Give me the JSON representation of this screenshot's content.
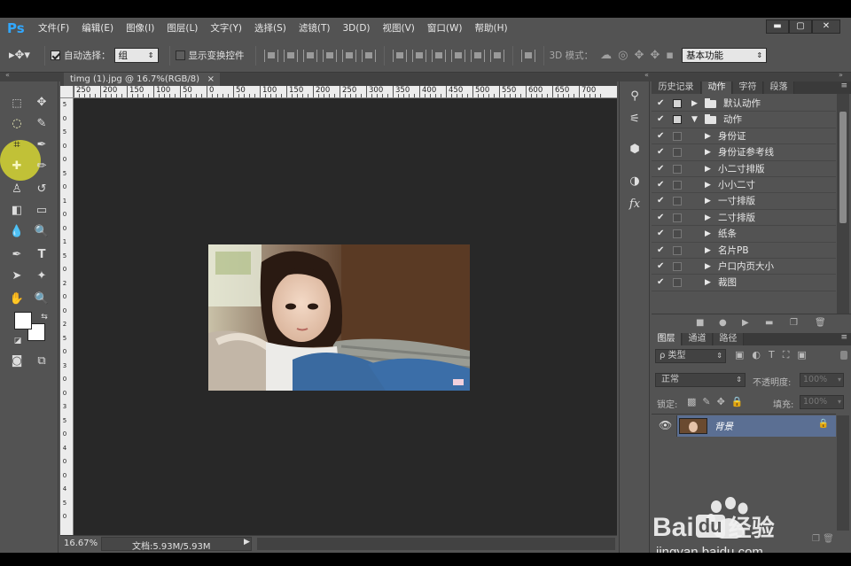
{
  "app": {
    "logo": "Ps"
  },
  "menu": [
    "文件(F)",
    "编辑(E)",
    "图像(I)",
    "图层(L)",
    "文字(Y)",
    "选择(S)",
    "滤镜(T)",
    "3D(D)",
    "视图(V)",
    "窗口(W)",
    "帮助(H)"
  ],
  "window_controls": {
    "minimize": "▬",
    "maximize": "▢",
    "close": "✕"
  },
  "options": {
    "auto_select_label": "自动选择：",
    "auto_select_value": "组",
    "show_transform_label": "显示变换控件",
    "mode_3d_label": "3D 模式：",
    "workspace_value": "基本功能"
  },
  "document": {
    "tab_title": "timg (1).jpg @ 16.7%(RGB/8)",
    "tab_close": "×",
    "zoom": "16.67%",
    "doc_info": "文档:5.93M/5.93M",
    "ruler_h": [
      "250",
      "200",
      "150",
      "100",
      "50",
      "0",
      "50",
      "100",
      "150",
      "200",
      "250",
      "300",
      "350",
      "400",
      "450",
      "500",
      "550",
      "600",
      "650",
      "700"
    ],
    "ruler_v": [
      "5",
      "0",
      "5",
      "0",
      "0",
      "5",
      "0",
      "1",
      "0",
      "0",
      "1",
      "5",
      "0",
      "2",
      "0",
      "0",
      "2",
      "5",
      "0",
      "3",
      "0",
      "0",
      "3",
      "5",
      "0",
      "4",
      "0",
      "0",
      "4",
      "5",
      "0"
    ]
  },
  "history_panel": {
    "tabs": [
      "历史记录",
      "动作",
      "字符",
      "段落"
    ],
    "active_tab": "动作",
    "rows": [
      {
        "check": "✔",
        "label": "默认动作",
        "level": 0,
        "folder": true,
        "expanded": false
      },
      {
        "check": "✔",
        "label": "动作",
        "level": 0,
        "folder": true,
        "expanded": true
      },
      {
        "check": "✔",
        "label": "身份证",
        "level": 1,
        "folder": false
      },
      {
        "check": "✔",
        "label": "身份证参考线",
        "level": 1,
        "folder": false
      },
      {
        "check": "✔",
        "label": "小二寸排版",
        "level": 1,
        "folder": false
      },
      {
        "check": "✔",
        "label": "小小二寸",
        "level": 1,
        "folder": false
      },
      {
        "check": "✔",
        "label": "一寸排版",
        "level": 1,
        "folder": false
      },
      {
        "check": "✔",
        "label": "二寸排版",
        "level": 1,
        "folder": false
      },
      {
        "check": "✔",
        "label": "纸条",
        "level": 1,
        "folder": false
      },
      {
        "check": "✔",
        "label": "名片PB",
        "level": 1,
        "folder": false
      },
      {
        "check": "✔",
        "label": "户口内页大小",
        "level": 1,
        "folder": false
      },
      {
        "check": "✔",
        "label": "裁图",
        "level": 1,
        "folder": false
      }
    ]
  },
  "layers_panel": {
    "tabs": [
      "图层",
      "通道",
      "路径"
    ],
    "active_tab": "图层",
    "kind_label": "ρ 类型",
    "blend_mode": "正常",
    "opacity_label": "不透明度:",
    "opacity_value": "100%",
    "lock_label": "锁定:",
    "fill_label": "填充:",
    "fill_value": "100%",
    "layers": [
      {
        "name": "背景",
        "visible": true,
        "locked": true
      }
    ]
  },
  "watermark": {
    "brand": "Bai",
    "brand_suffix": "du",
    "cn": "经验",
    "url": "jingyan.baidu.com"
  },
  "colors": {
    "bg": "#535353",
    "canvas": "#282828",
    "selected_layer": "#5b6f93",
    "ps_blue": "#31a8ff",
    "highlight": "#e6e62e"
  }
}
